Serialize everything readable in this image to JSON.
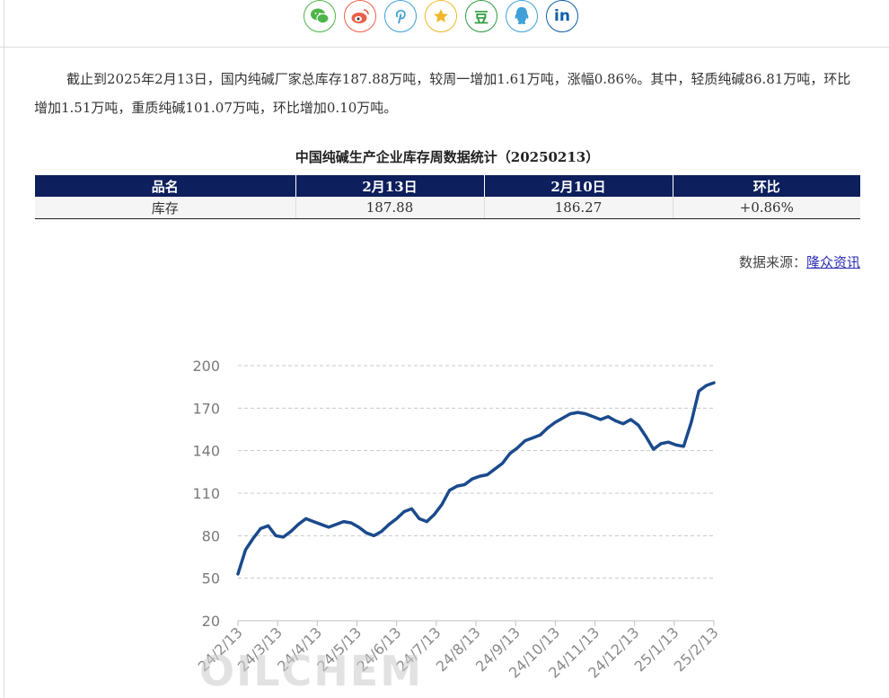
{
  "share_icons": [
    {
      "name": "wechat-icon",
      "color": "#4cb548"
    },
    {
      "name": "weibo-icon",
      "color": "#e8604a"
    },
    {
      "name": "pinterest-icon",
      "color": "#3fa0d8"
    },
    {
      "name": "qzone-star-icon",
      "color": "#f0b82a"
    },
    {
      "name": "douban-icon",
      "color": "#2f9a3e",
      "glyph": "豆"
    },
    {
      "name": "qq-icon",
      "color": "#3fa0d8"
    },
    {
      "name": "linkedin-icon",
      "color": "#0e5fa8",
      "glyph": "in"
    }
  ],
  "article": {
    "paragraph": "截止到2025年2月13日，国内纯碱厂家总库存187.88万吨，较周一增加1.61万吨，涨幅0.86%。其中，轻质纯碱86.81万吨，环比增加1.51万吨，重质纯碱101.07万吨，环比增加0.10万吨。"
  },
  "table": {
    "title": "中国纯碱生产企业库存周数据统计（20250213）",
    "headers": [
      "品名",
      "2月13日",
      "2月10日",
      "环比"
    ],
    "rows": [
      [
        "库存",
        "187.88",
        "186.27",
        "+0.86%"
      ]
    ]
  },
  "source": {
    "label": "数据来源：",
    "link": "隆众资讯"
  },
  "chart_data": {
    "type": "line",
    "title": "",
    "xlabel": "",
    "ylabel": "",
    "ylim": [
      20,
      200
    ],
    "yticks": [
      20,
      50,
      80,
      110,
      140,
      170,
      200
    ],
    "grid": "horizontal dashed",
    "line_color": "#1b4a8c",
    "categories": [
      "24/2/13",
      "24/3/13",
      "24/4/13",
      "24/5/13",
      "24/6/13",
      "24/7/13",
      "24/8/13",
      "24/9/13",
      "24/10/13",
      "24/11/13",
      "24/12/13",
      "25/1/13",
      "25/2/13"
    ],
    "series": [
      {
        "values": [
          53,
          70,
          78,
          85,
          87,
          80,
          79,
          83,
          88,
          92,
          90,
          88,
          86,
          88,
          90,
          89,
          86,
          82,
          80,
          83,
          88,
          92,
          97,
          99,
          92,
          90,
          95,
          102,
          112,
          115,
          116,
          120,
          122,
          123,
          127,
          131,
          138,
          142,
          147,
          149,
          151,
          156,
          160,
          163,
          166,
          167,
          166,
          164,
          162,
          164,
          161,
          159,
          162,
          158,
          150,
          141,
          145,
          146,
          144,
          143,
          160,
          182,
          186,
          187.88
        ]
      }
    ],
    "watermark": "OILCHEM"
  }
}
